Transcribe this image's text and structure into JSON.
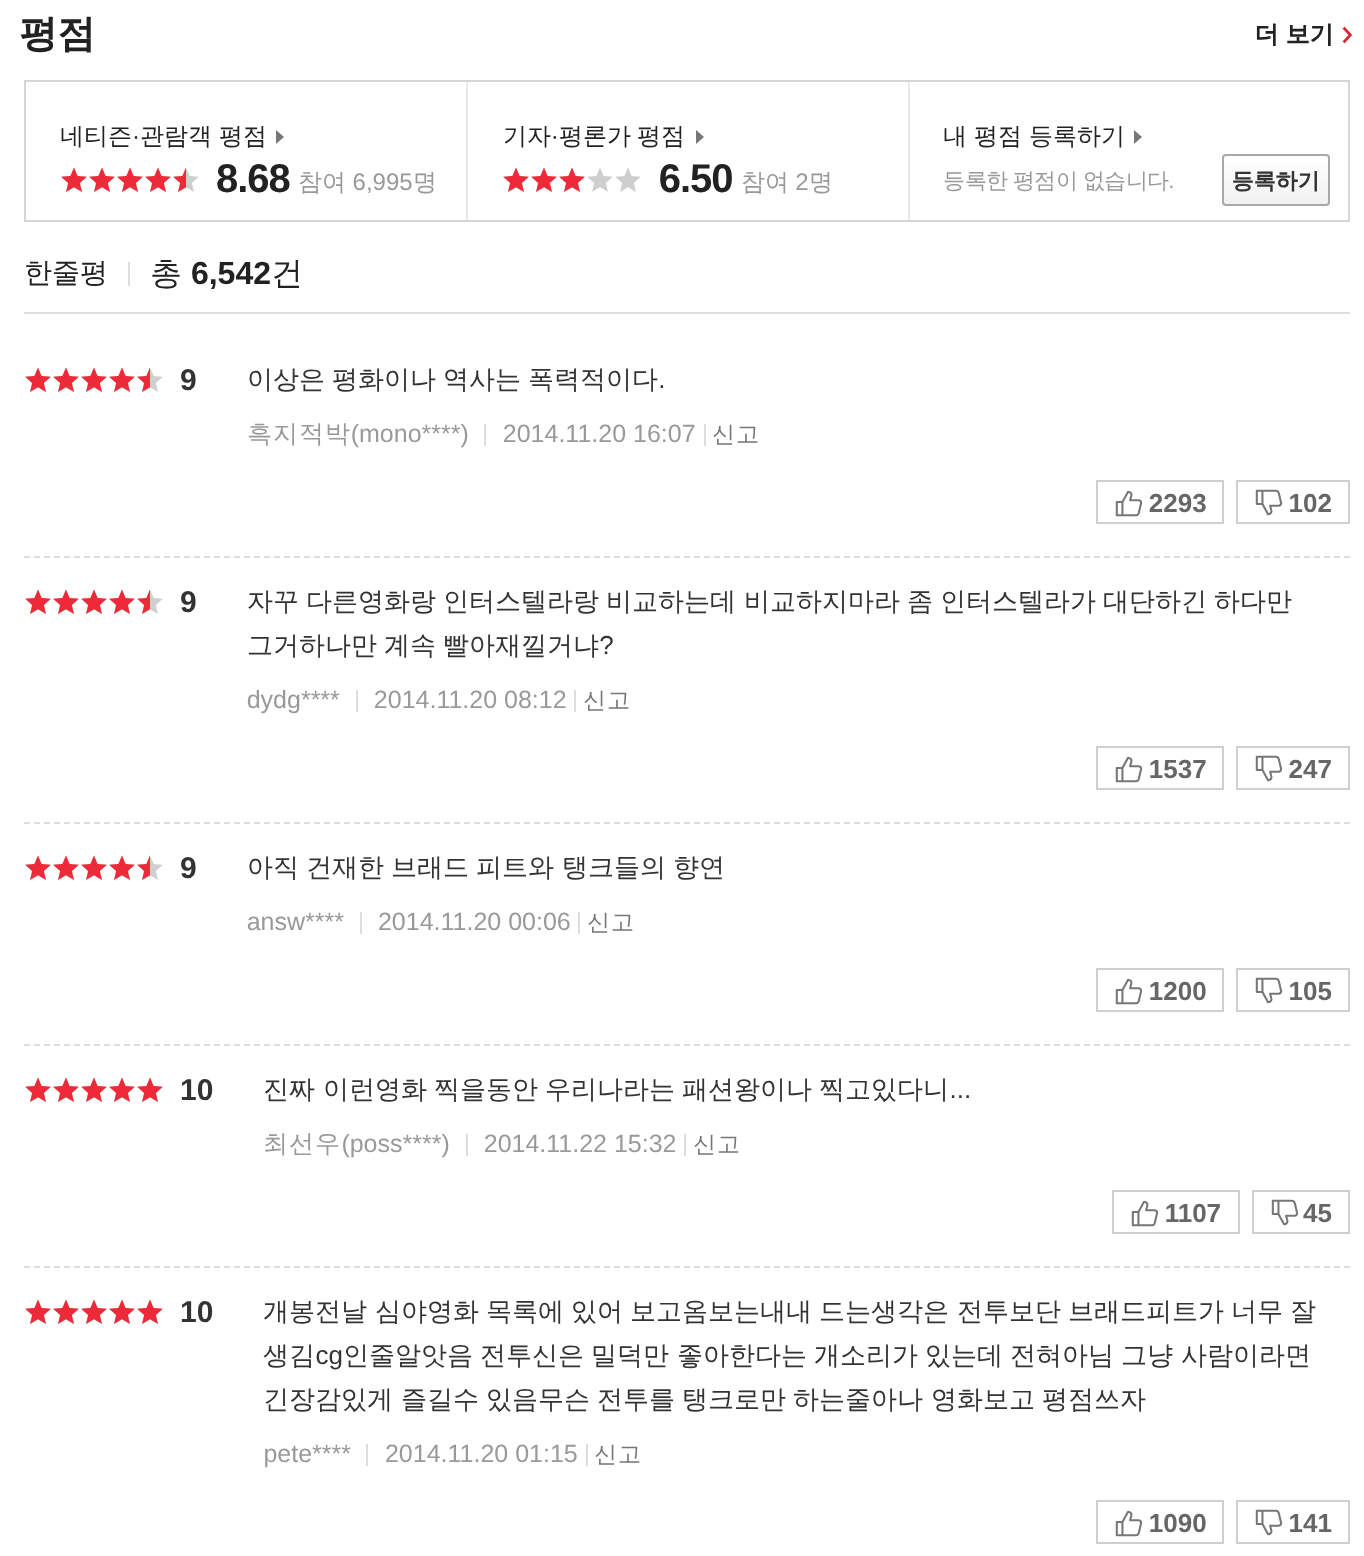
{
  "header": {
    "title": "평점",
    "more_link": "더 보기"
  },
  "summary": [
    {
      "kind": "score",
      "label": "네티즌·관람객 평점",
      "stars": 4.5,
      "score": "8.68",
      "participants": "참여 6,995명"
    },
    {
      "kind": "score",
      "label": "기자·평론가 평점",
      "stars": 3,
      "score": "6.50",
      "participants": "참여 2명"
    },
    {
      "kind": "register",
      "label": "내 평점 등록하기",
      "message": "등록한 평점이 없습니다.",
      "button": "등록하기"
    }
  ],
  "reviews_header": {
    "title": "한줄평",
    "total": "총 **6,542**건"
  },
  "reviews": [
    {
      "stars": 4.5,
      "score": "9",
      "text": "이상은 평화이나 역사는 폭력적이다.",
      "author": "흑지적박(mono****)",
      "date": "2014.11.20 16:07",
      "report": "신고",
      "likes": "2293",
      "dislikes": "102"
    },
    {
      "stars": 4.5,
      "score": "9",
      "text": "자꾸 다른영화랑 인터스텔라랑 비교하는데 비교하지마라 좀 인터스텔라가 대단하긴 하다만 그거하나만 계속 빨아재낄거냐?",
      "author": "dydg****",
      "date": "2014.11.20 08:12",
      "report": "신고",
      "likes": "1537",
      "dislikes": "247"
    },
    {
      "stars": 4.5,
      "score": "9",
      "text": "아직 건재한 브래드 피트와 탱크들의 향연",
      "author": "answ****",
      "date": "2014.11.20 00:06",
      "report": "신고",
      "likes": "1200",
      "dislikes": "105"
    },
    {
      "stars": 5,
      "score": "10",
      "text": "진짜 이런영화 찍을동안 우리나라는 패션왕이나 찍고있다니...",
      "author": "최선우(poss****)",
      "date": "2014.11.22 15:32",
      "report": "신고",
      "likes": "1107",
      "dislikes": "45"
    },
    {
      "stars": 5,
      "score": "10",
      "text": "개봉전날 심야영화 목록에 있어 보고옴보는내내 드는생각은 전투보단 브래드피트가 너무 잘생김cg인줄알앗음 전투신은 밀덕만 좋아한다는 개소리가 있는데 전혀아님 그냥 사람이라면 긴장감있게 즐길수 있음무슨 전투를 탱크로만 하는줄아나 영화보고 평점쓰자",
      "author": "pete****",
      "date": "2014.11.20 01:15",
      "report": "신고",
      "likes": "1090",
      "dislikes": "141"
    }
  ]
}
